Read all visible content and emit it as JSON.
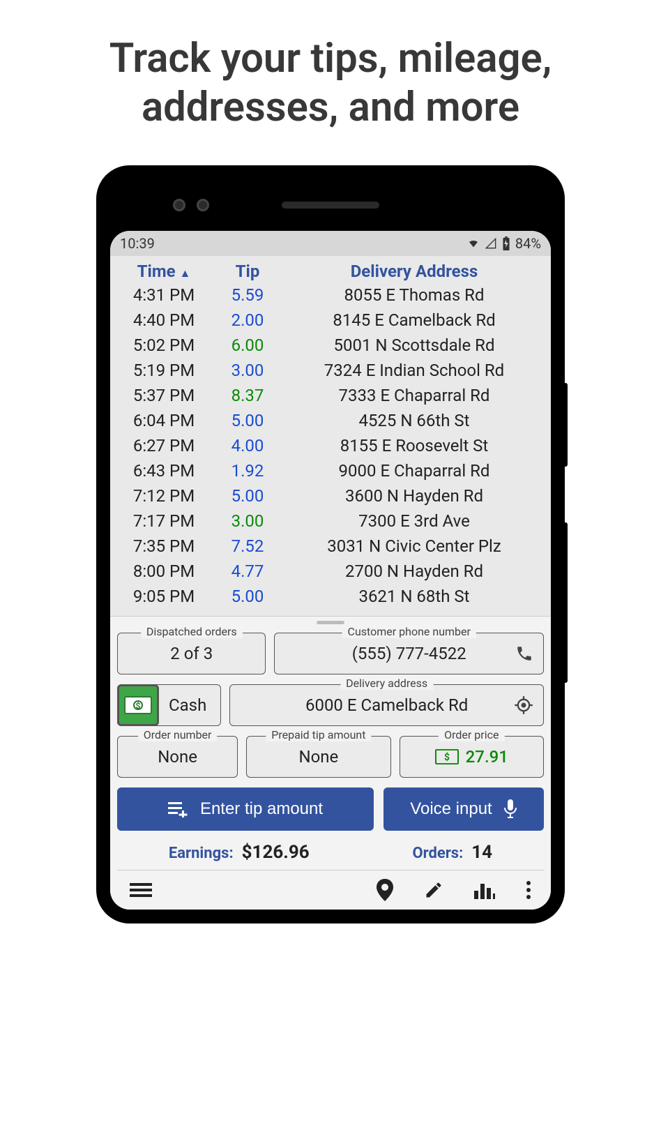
{
  "hero": "Track your tips, mileage, addresses, and more",
  "status": {
    "time": "10:39",
    "battery": "84%"
  },
  "headers": {
    "time": "Time",
    "tip": "Tip",
    "address": "Delivery Address"
  },
  "rows": [
    {
      "time": "4:31 PM",
      "tip": "5.59",
      "tipColor": "blue",
      "address": "8055 E Thomas Rd"
    },
    {
      "time": "4:40 PM",
      "tip": "2.00",
      "tipColor": "blue",
      "address": "8145 E Camelback Rd"
    },
    {
      "time": "5:02 PM",
      "tip": "6.00",
      "tipColor": "green",
      "address": "5001 N Scottsdale Rd"
    },
    {
      "time": "5:19 PM",
      "tip": "3.00",
      "tipColor": "blue",
      "address": "7324 E Indian School Rd"
    },
    {
      "time": "5:37 PM",
      "tip": "8.37",
      "tipColor": "green",
      "address": "7333 E Chaparral Rd"
    },
    {
      "time": "6:04 PM",
      "tip": "5.00",
      "tipColor": "blue",
      "address": "4525 N 66th St"
    },
    {
      "time": "6:27 PM",
      "tip": "4.00",
      "tipColor": "blue",
      "address": "8155 E Roosevelt St"
    },
    {
      "time": "6:43 PM",
      "tip": "1.92",
      "tipColor": "blue",
      "address": "9000 E Chaparral Rd"
    },
    {
      "time": "7:12 PM",
      "tip": "5.00",
      "tipColor": "blue",
      "address": "3600 N Hayden Rd"
    },
    {
      "time": "7:17 PM",
      "tip": "3.00",
      "tipColor": "green",
      "address": "7300 E 3rd Ave"
    },
    {
      "time": "7:35 PM",
      "tip": "7.52",
      "tipColor": "blue",
      "address": "3031 N Civic Center Plz"
    },
    {
      "time": "8:00 PM",
      "tip": "4.77",
      "tipColor": "blue",
      "address": "2700 N Hayden Rd"
    },
    {
      "time": "9:05 PM",
      "tip": "5.00",
      "tipColor": "blue",
      "address": "3621 N 68th St"
    }
  ],
  "panel": {
    "dispatched": {
      "label": "Dispatched orders",
      "value": "2 of 3"
    },
    "phone": {
      "label": "Customer phone number",
      "value": "(555) 777-4522"
    },
    "cash": "Cash",
    "delivery": {
      "label": "Delivery address",
      "value": "6000 E Camelback Rd"
    },
    "orderNumber": {
      "label": "Order number",
      "value": "None"
    },
    "prepaid": {
      "label": "Prepaid tip amount",
      "value": "None"
    },
    "price": {
      "label": "Order price",
      "value": "27.91"
    },
    "enterTip": "Enter tip amount",
    "voice": "Voice input"
  },
  "summary": {
    "earningsLabel": "Earnings:",
    "earningsValue": "$126.96",
    "ordersLabel": "Orders:",
    "ordersValue": "14"
  }
}
